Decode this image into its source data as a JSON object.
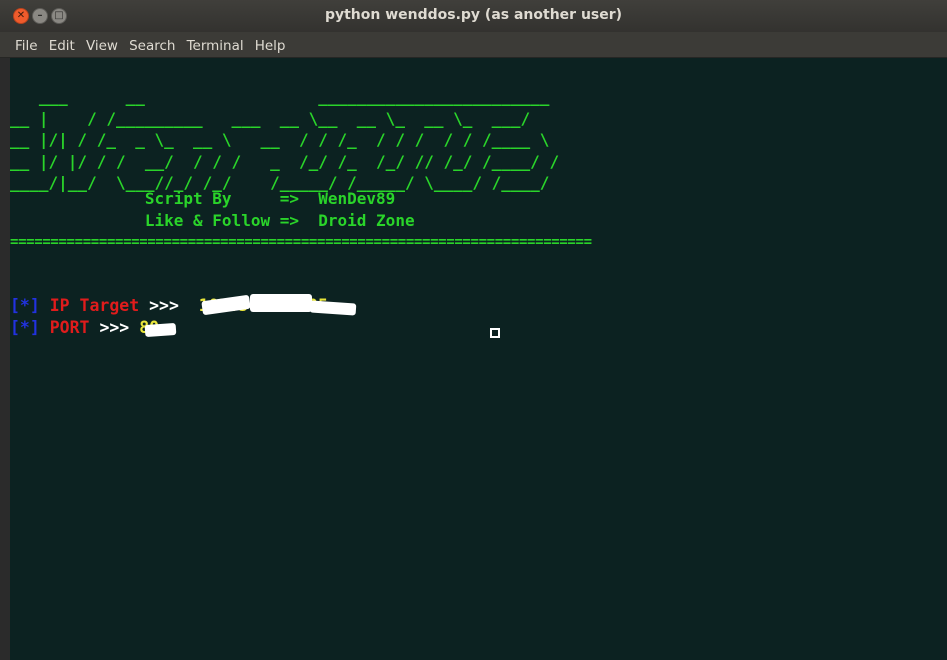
{
  "window": {
    "title": "python wenddos.py (as another user)",
    "close_glyph": "✕",
    "min_glyph": "–",
    "max_glyph": "□"
  },
  "menu": [
    "File",
    "Edit",
    "View",
    "Search",
    "Terminal",
    "Help"
  ],
  "terminal": {
    "banner": "   ___      __                  ________________________\n__ |    / /_________   ___  __ \\__  __ \\_  __ \\_  ___/\n__ |/| / /_  _ \\_  __ \\   __  / / /_  / / /  / / /____ \\\n__ |/ |/ / /  __/  / / /   _  /_/ /_  /_/ // /_/ /____/ /\n____/|__/  \\___//_/ /_/    /_____/ /_____/ \\____/ /____/",
    "credit_line_1": "              Script By     =>  WenDev89",
    "credit_line_2": "              Like & Follow =>  Droid Zone",
    "separator": "========================================================================",
    "prompt1": {
      "bracket": "[*]",
      "label": "IP Target",
      "arrows": ">>>",
      "value": "103.5    .105"
    },
    "prompt2": {
      "bracket": "[*]",
      "label": "PORT",
      "arrows": ">>>",
      "value": "80"
    }
  },
  "colors": {
    "terminal_bg": "#0c2221",
    "banner_green": "#2ad42a",
    "label_red": "#e01c1c",
    "bracket_blue": "#2232e0",
    "value_yellow": "#e8e53a"
  }
}
